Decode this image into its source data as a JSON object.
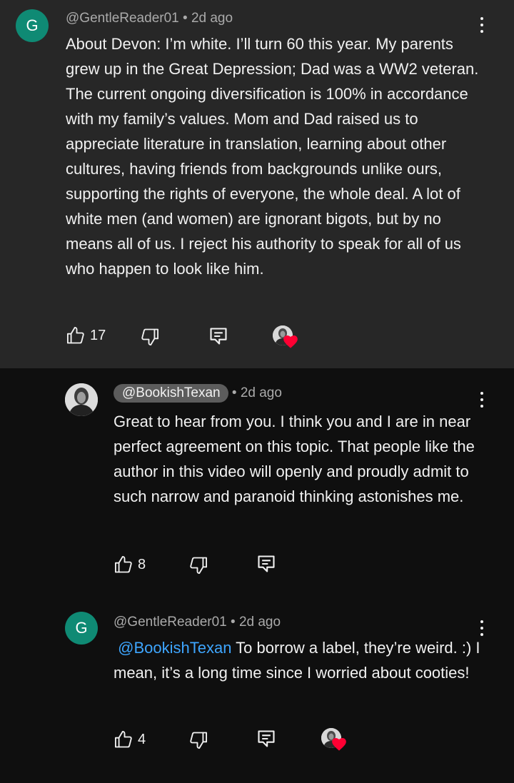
{
  "comments": [
    {
      "avatar_letter": "G",
      "handle": "@GentleReader01",
      "separator": "•",
      "time": "2d ago",
      "body": "About Devon: I’m white. I’ll turn 60 this year. My parents grew up in the Great Depression; Dad was a WW2 veteran. The current ongoing diversification is 100% in accordance with my family’s values. Mom and Dad raised us to appreciate literature in translation, learning about other cultures, having friends from backgrounds unlike ours, supporting the rights of everyone, the whole deal. A lot of white men (and women) are ignorant bigots, but by no means all of us. I reject his authority to speak for all of us who happen to look like him.",
      "likes": "17",
      "creator_hearted": true
    },
    {
      "avatar_kind": "photo",
      "handle": "@BookishTexan",
      "separator": "•",
      "time": "2d ago",
      "body": "Great to hear from you. I think you and I are in near perfect agreement on this topic. That people like the author in this video will openly and proudly admit to such narrow and paranoid thinking astonishes me.",
      "likes": "8",
      "creator_hearted": false
    },
    {
      "avatar_letter": "G",
      "handle": "@GentleReader01",
      "separator": "•",
      "time": "2d ago",
      "mention": "@BookishTexan",
      "body": " To borrow a label, they’re weird. :) I mean, it’s a long time since I worried about cooties!",
      "likes": "4",
      "creator_hearted": true
    }
  ],
  "icons": {
    "like": "thumbs-up-icon",
    "dislike": "thumbs-down-icon",
    "reply": "reply-icon",
    "more": "more-vertical-icon",
    "heart": "heart-icon"
  },
  "colors": {
    "background": "#0f0f0f",
    "highlight_background": "#272727",
    "avatar": "#0f8a74",
    "mention": "#3ea6ff",
    "heart": "#ff0033"
  }
}
